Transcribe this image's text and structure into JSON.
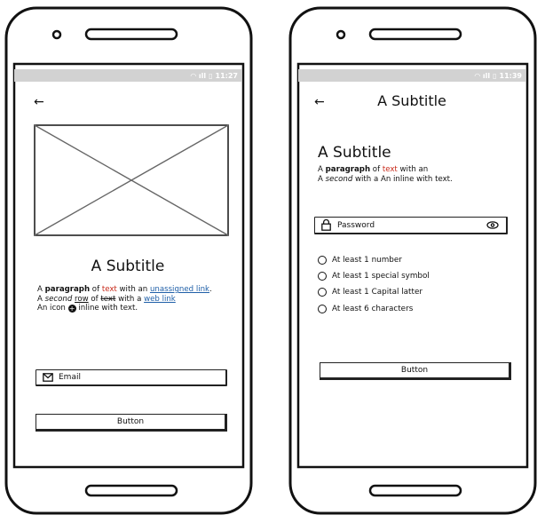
{
  "left_screen": {
    "status_time": "11:27",
    "back_icon": "arrow-left-icon",
    "subtitle": "A Subtitle",
    "paragraph": {
      "line1_a": "A ",
      "line1_bold": "paragraph",
      "line1_b": " of ",
      "line1_red": "text",
      "line1_c": " with an ",
      "line1_link": "unassigned link",
      "line1_d": ".",
      "line2_a": "A ",
      "line2_italic": "second",
      "line2_b": " ",
      "line2_under": "row",
      "line2_c": " of ",
      "line2_strike": "text",
      "line2_d": " with a ",
      "line2_link": "web link",
      "line3_a": "An icon ",
      "line3_b": " inline with text."
    },
    "email_placeholder": "Email",
    "button_label": "Button"
  },
  "right_screen": {
    "status_time": "11:39",
    "back_icon": "arrow-left-icon",
    "header_title": "A Subtitle",
    "subtitle": "A Subtitle",
    "paragraph": {
      "line1_a": "A ",
      "line1_bold": "paragraph",
      "line1_b": " of ",
      "line1_red": "text",
      "line1_c": " with an",
      "line2_a": "A ",
      "line2_italic": "second",
      "line2_b": " with a An inline with text."
    },
    "password_placeholder": "Password",
    "rules": [
      "At least 1 number",
      "At least 1 special symbol",
      "At least 1 Capital latter",
      "At least 6 characters"
    ],
    "button_label": "Button"
  }
}
